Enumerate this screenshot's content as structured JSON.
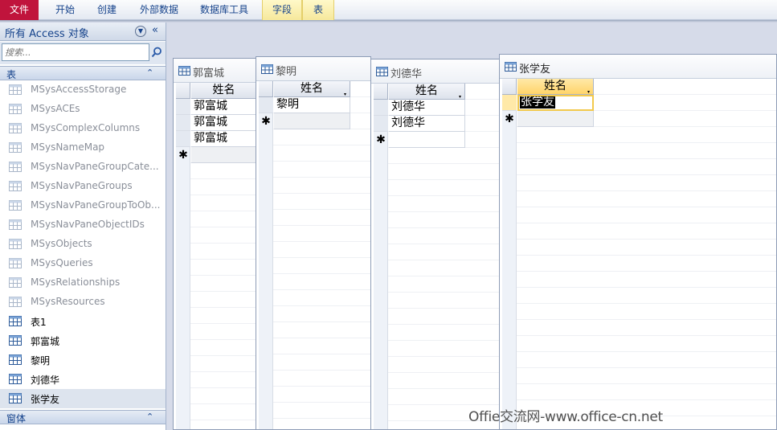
{
  "ribbon": {
    "tabs": [
      {
        "label": "文件"
      },
      {
        "label": "开始"
      },
      {
        "label": "创建"
      },
      {
        "label": "外部数据"
      },
      {
        "label": "数据库工具"
      },
      {
        "label": "字段"
      },
      {
        "label": "表"
      }
    ]
  },
  "nav": {
    "title": "所有 Access 对象",
    "collapse_icon": "«",
    "search_placeholder": "搜索...",
    "groups": {
      "tables": {
        "label": "表",
        "chevron": "⌃"
      },
      "forms": {
        "label": "窗体",
        "chevron": "⌃"
      }
    },
    "items": [
      {
        "label": "MSysAccessStorage",
        "system": true
      },
      {
        "label": "MSysACEs",
        "system": true
      },
      {
        "label": "MSysComplexColumns",
        "system": true
      },
      {
        "label": "MSysNameMap",
        "system": true
      },
      {
        "label": "MSysNavPaneGroupCate...",
        "system": true
      },
      {
        "label": "MSysNavPaneGroups",
        "system": true
      },
      {
        "label": "MSysNavPaneGroupToOb...",
        "system": true
      },
      {
        "label": "MSysNavPaneObjectIDs",
        "system": true
      },
      {
        "label": "MSysObjects",
        "system": true
      },
      {
        "label": "MSysQueries",
        "system": true
      },
      {
        "label": "MSysRelationships",
        "system": true
      },
      {
        "label": "MSysResources",
        "system": true
      },
      {
        "label": "表1",
        "system": false
      },
      {
        "label": "郭富城",
        "system": false
      },
      {
        "label": "黎明",
        "system": false
      },
      {
        "label": "刘德华",
        "system": false
      },
      {
        "label": "张学友",
        "system": false,
        "selected": true
      }
    ]
  },
  "windows": [
    {
      "title": "郭富城",
      "column": "姓名",
      "rows": [
        "郭富城",
        "郭富城",
        "郭富城"
      ]
    },
    {
      "title": "黎明",
      "column": "姓名",
      "rows": [
        "黎明"
      ]
    },
    {
      "title": "刘德华",
      "column": "姓名",
      "rows": [
        "刘德华",
        "刘德华"
      ]
    },
    {
      "title": "张学友",
      "column": "姓名",
      "rows": [
        "张学友"
      ],
      "active": true
    }
  ],
  "new_row_marker": "✱",
  "dropdown_marker": "▾",
  "watermark": "Offie交流网-www.office-cn.net",
  "colors": {
    "file_tab": "#c0143c",
    "active_header": "#ffd46a",
    "nav_text": "#15428b"
  }
}
